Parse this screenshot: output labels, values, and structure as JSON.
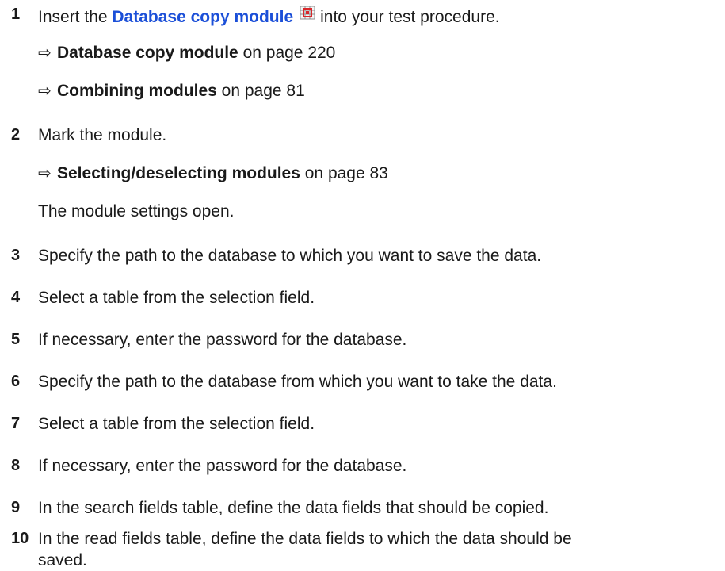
{
  "steps": {
    "s1": {
      "num": "1",
      "pre": "Insert the ",
      "link": "Database copy module",
      "icon": "database-copy-module-icon",
      "post": "into your test procedure.",
      "refs": [
        {
          "title": "Database copy module",
          "suffix": " on page 220"
        },
        {
          "title": "Combining modules",
          "suffix": " on page 81"
        }
      ]
    },
    "s2": {
      "num": "2",
      "text": "Mark the module.",
      "refs": [
        {
          "title": "Selecting/deselecting modules",
          "suffix": " on page 83"
        }
      ],
      "result": "The module settings open."
    },
    "s3": {
      "num": "3",
      "text": "Specify the path to the database to which you want to save the data."
    },
    "s4": {
      "num": "4",
      "text": "Select a table from the selection field."
    },
    "s5": {
      "num": "5",
      "text": "If necessary, enter the password for the database."
    },
    "s6": {
      "num": "6",
      "text": "Specify the path to the database from which you want to take the data."
    },
    "s7": {
      "num": "7",
      "text": "Select a table from the selection field."
    },
    "s8": {
      "num": "8",
      "text": "If necessary, enter the password for the database."
    },
    "s9": {
      "num": "9",
      "text": "In the search fields table, define the data fields that should be copied."
    },
    "s10": {
      "num": "10",
      "text_line1": "In the read fields table, define the data fields to which the data should be",
      "text_line2": "saved."
    }
  },
  "arrow_symbol": "⇨",
  "colors": {
    "link": "#1b4fd8",
    "icon_red": "#d9262a",
    "icon_grid": "#8f8f8f"
  }
}
